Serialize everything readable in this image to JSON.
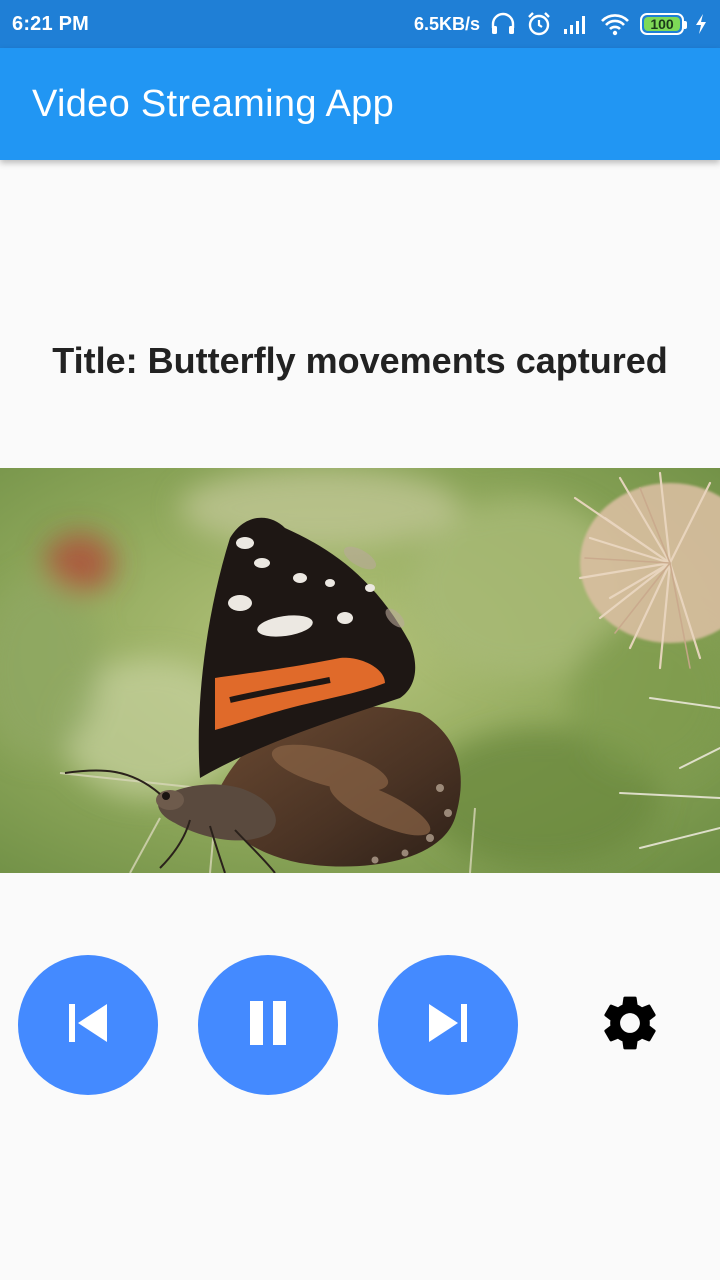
{
  "status_bar": {
    "time": "6:21 PM",
    "network_speed": "6.5KB/s",
    "battery_level": "100",
    "icons": [
      "headphones-icon",
      "alarm-icon",
      "signal-icon",
      "wifi-icon",
      "battery-icon",
      "charging-icon"
    ]
  },
  "app_bar": {
    "title": "Video Streaming App",
    "color": "#2196f3"
  },
  "video": {
    "title": "Title: Butterfly movements captured"
  },
  "controls": {
    "button_color": "#448aff",
    "previous_icon": "skip-previous-icon",
    "pause_icon": "pause-icon",
    "next_icon": "skip-next-icon",
    "settings_icon": "gear-icon"
  }
}
